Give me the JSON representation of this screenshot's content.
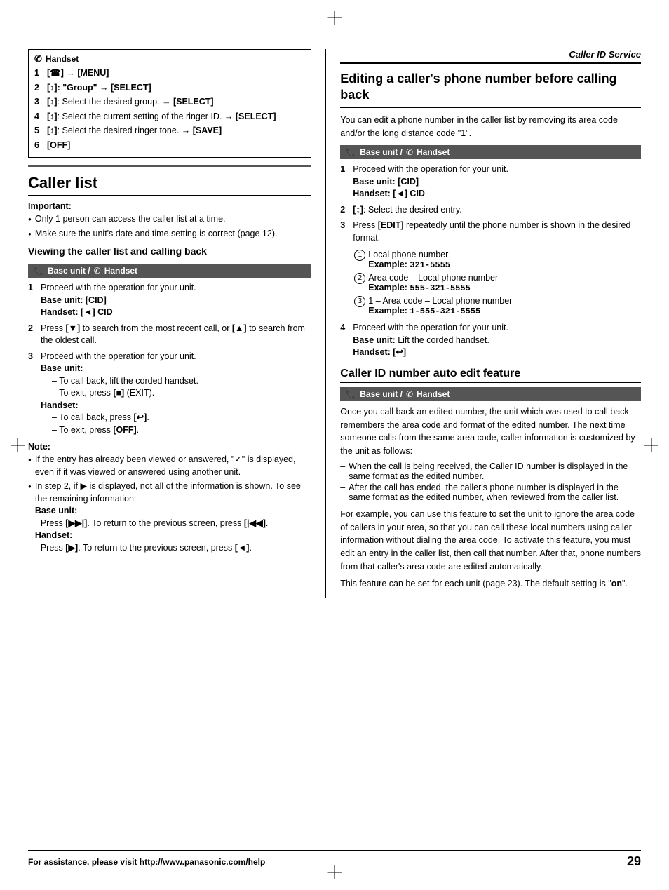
{
  "page": {
    "number": "29",
    "footer_text": "For assistance, please visit http://www.panasonic.com/help",
    "header_title": "Caller ID Service"
  },
  "left_col": {
    "handset_section": {
      "label": "Handset",
      "steps": [
        {
          "num": "1",
          "text": "[☎] → [MENU]"
        },
        {
          "num": "2",
          "text": "[↕]: \"Group\" → [SELECT]"
        },
        {
          "num": "3",
          "text": "[↕]: Select the desired group. → [SELECT]"
        },
        {
          "num": "4",
          "text": "[↕]: Select the current setting of the ringer ID. → [SELECT]"
        },
        {
          "num": "5",
          "text": "[↕]: Select the desired ringer tone. → [SAVE]"
        },
        {
          "num": "6",
          "text": "[OFF]"
        }
      ]
    },
    "caller_list": {
      "title": "Caller list",
      "important_label": "Important:",
      "important_bullets": [
        "Only 1 person can access the caller list at a time.",
        "Make sure the unit's date and time setting is correct (page 12)."
      ],
      "viewing_section": {
        "title": "Viewing the caller list and calling back",
        "base_handset_label": "Base unit / Handset",
        "steps": [
          {
            "num": "1",
            "text": "Proceed with the operation for your unit.",
            "sub": [
              "Base unit: [CID]",
              "Handset: [◄] CID"
            ]
          },
          {
            "num": "2",
            "text": "Press [▼] to search from the most recent call, or [▲] to search from the oldest call."
          },
          {
            "num": "3",
            "text": "Proceed with the operation for your unit.",
            "sub_base": [
              "Base unit:",
              "– To call back, lift the corded handset.",
              "– To exit, press [■] (EXIT)."
            ],
            "sub_handset": [
              "Handset:",
              "– To call back, press [↩].",
              "– To exit, press [OFF]."
            ]
          }
        ]
      },
      "note_section": {
        "label": "Note:",
        "bullets": [
          "If the entry has already been viewed or answered, \"✓\" is displayed, even if it was viewed or answered using another unit.",
          "In step 2, if ▶ is displayed, not all of the information is shown. To see the remaining information:",
          "Base unit:",
          "Press [▶▶|]. To return to the previous screen, press [|◀◀].",
          "Handset:",
          "Press [▶]. To return to the previous screen, press [◄]."
        ]
      }
    }
  },
  "right_col": {
    "header": "Caller ID Service",
    "editing_section": {
      "title": "Editing a caller's phone number before calling back",
      "intro": "You can edit a phone number in the caller list by removing its area code and/or the long distance code \"1\".",
      "base_handset_label": "Base unit / Handset",
      "steps": [
        {
          "num": "1",
          "text": "Proceed with the operation for your unit.",
          "sub": [
            "Base unit: [CID]",
            "Handset: [◄] CID"
          ]
        },
        {
          "num": "2",
          "text": "[↕]: Select the desired entry."
        },
        {
          "num": "3",
          "text": "Press [EDIT] repeatedly until the phone number is shown in the desired format."
        }
      ],
      "formats": [
        {
          "circle_num": "1",
          "label": "Local phone number",
          "example_label": "Example:",
          "example_value": "321-5555"
        },
        {
          "circle_num": "2",
          "label": "Area code – Local phone number",
          "example_label": "Example:",
          "example_value": "555-321-5555"
        },
        {
          "circle_num": "3",
          "label": "1 – Area code – Local phone number",
          "example_label": "Example:",
          "example_value": "1-555-321-5555"
        }
      ],
      "step4": {
        "num": "4",
        "text": "Proceed with the operation for your unit.",
        "sub": [
          "Base unit: Lift the corded handset.",
          "Handset: [↩]"
        ]
      }
    },
    "auto_edit_section": {
      "title": "Caller ID number auto edit feature",
      "base_handset_label": "Base unit / Handset",
      "body_paragraphs": [
        "Once you call back an edited number, the unit which was used to call back remembers the area code and format of the edited number. The next time someone calls from the same area code, caller information is customized by the unit as follows:",
        "– When the call is being received, the Caller ID number is displayed in the same format as the edited number.",
        "– After the call has ended, the caller's phone number is displayed in the same format as the edited number, when reviewed from the caller list.",
        "For example, you can use this feature to set the unit to ignore the area code of callers in your area, so that you can call these local numbers using caller information without dialing the area code. To activate this feature, you must edit an entry in the caller list, then call that number. After that, phone numbers from that caller's area code are edited automatically.",
        "This feature can be set for each unit (page 23). The default setting is \"on\"."
      ]
    }
  }
}
